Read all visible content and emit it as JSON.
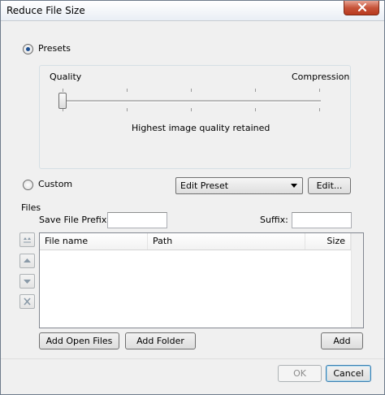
{
  "window": {
    "title": "Reduce File Size"
  },
  "mode": {
    "presets_label": "Presets",
    "custom_label": "Custom",
    "selected": "Presets"
  },
  "slider": {
    "left_label": "Quality",
    "right_label": "Compression",
    "description": "Highest image quality retained",
    "value_fraction": 0.0
  },
  "preset": {
    "selected": "Edit Preset",
    "edit_button": "Edit..."
  },
  "files": {
    "group_label": "Files",
    "prefix_label": "Save File Prefix:",
    "prefix_value": "",
    "suffix_label": "Suffix:",
    "suffix_value": "",
    "columns": [
      "File name",
      "Path",
      "Size"
    ],
    "rows": [],
    "add_open_files": "Add Open Files",
    "add_folder": "Add Folder",
    "add": "Add"
  },
  "dialog": {
    "ok": "OK",
    "cancel": "Cancel"
  },
  "colors": {
    "close_button": "#c7543a",
    "radio_dot": "#1d4f91",
    "default_button_border": "#3c7fb1"
  },
  "icons": {
    "close": "close-icon",
    "move_top": "move-to-top-icon",
    "move_up": "move-up-icon",
    "move_down": "move-down-icon",
    "remove": "remove-icon",
    "dropdown": "chevron-down-icon"
  }
}
